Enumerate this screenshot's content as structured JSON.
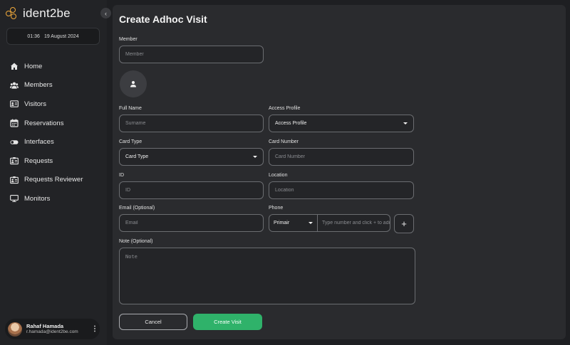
{
  "app": {
    "logo_text": "ident2be"
  },
  "sidebar": {
    "time": "01:36",
    "date": "19 August 2024",
    "items": [
      {
        "label": "Home",
        "icon": "home-icon"
      },
      {
        "label": "Members",
        "icon": "members-icon"
      },
      {
        "label": "Visitors",
        "icon": "visitors-icon"
      },
      {
        "label": "Reservations",
        "icon": "calendar-icon"
      },
      {
        "label": "Interfaces",
        "icon": "toggle-icon"
      },
      {
        "label": "Requests",
        "icon": "requests-icon"
      },
      {
        "label": "Requests Reviewer",
        "icon": "requests-reviewer-icon"
      },
      {
        "label": "Monitors",
        "icon": "monitor-icon"
      }
    ],
    "user": {
      "name": "Rahaf Hamada",
      "email": "r.hamada@ident2be.com"
    }
  },
  "form": {
    "title": "Create Adhoc Visit",
    "member": {
      "label": "Member",
      "placeholder": "Member"
    },
    "full_name": {
      "label": "Full Name",
      "placeholder": "Surname"
    },
    "access_profile": {
      "label": "Access Profile",
      "value": "Access Profile"
    },
    "card_type": {
      "label": "Card Type",
      "value": "Card Type"
    },
    "card_number": {
      "label": "Card Number",
      "placeholder": "Card Number"
    },
    "id": {
      "label": "ID",
      "placeholder": "ID"
    },
    "location": {
      "label": "Location",
      "placeholder": "Location"
    },
    "email": {
      "label": "Email (Optional)",
      "placeholder": "Email"
    },
    "phone": {
      "label": "Phone",
      "country": "Primair",
      "placeholder": "Type number and click + to add",
      "add_label": "+"
    },
    "note": {
      "label": "Note (Optional)",
      "placeholder": "Note"
    },
    "cancel_label": "Cancel",
    "create_label": "Create Visit"
  },
  "colors": {
    "accent": "#2fb26a",
    "logo": "#f0a93b",
    "background": "#1e1f22",
    "panel": "#2a2b2e"
  }
}
